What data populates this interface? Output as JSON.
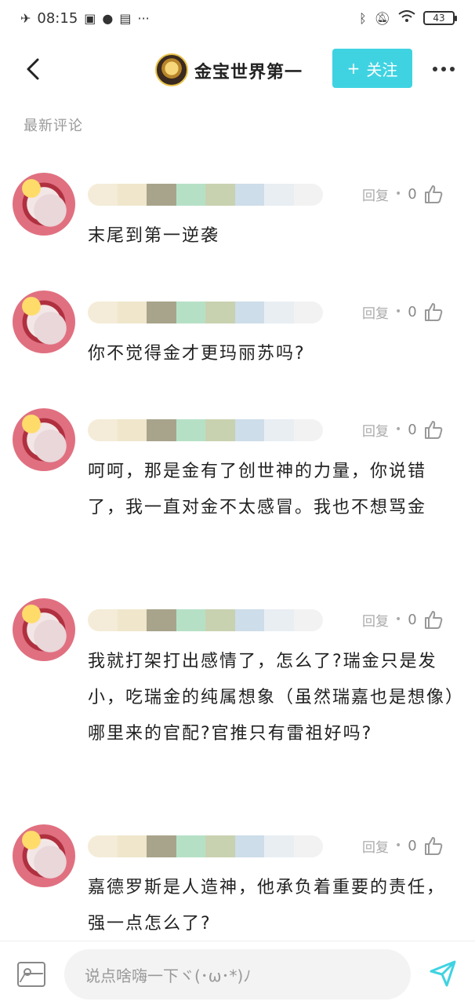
{
  "status_bar": {
    "time": "08:15",
    "left_icons": [
      "airplane-icon",
      "app-icon",
      "wechat-icon",
      "message-icon",
      "more-notifications-icon"
    ],
    "right_icons": [
      "bluetooth-icon",
      "mute-icon",
      "wifi-icon"
    ],
    "battery": "43",
    "more_glyph": "···"
  },
  "header": {
    "title": "金宝世界第一",
    "follow_label": "关注",
    "follow_plus": "+",
    "accent_color": "#3fd3e2"
  },
  "section_label": "最新评论",
  "comments": [
    {
      "reply_label": "回复",
      "dot": "•",
      "likes": "0",
      "text": "末尾到第一逆袭"
    },
    {
      "reply_label": "回复",
      "dot": "•",
      "likes": "0",
      "text": "你不觉得金才更玛丽苏吗?"
    },
    {
      "reply_label": "回复",
      "dot": "•",
      "likes": "0",
      "text": "呵呵，那是金有了创世神的力量，你说错了，我一直对金不太感冒。我也不想骂金"
    },
    {
      "reply_label": "回复",
      "dot": "•",
      "likes": "0",
      "text": "我就打架打出感情了，怎么了?瑞金只是发小，吃瑞金的纯属想象（虽然瑞嘉也是想像）哪里来的官配?官推只有雷祖好吗?"
    },
    {
      "reply_label": "回复",
      "dot": "•",
      "likes": "0",
      "text": "嘉德罗斯是人造神，他承负着重要的责任，强一点怎么了?"
    }
  ],
  "input": {
    "placeholder": "说点啥嗨一下ヾ(･ω･*)ﾉ"
  }
}
